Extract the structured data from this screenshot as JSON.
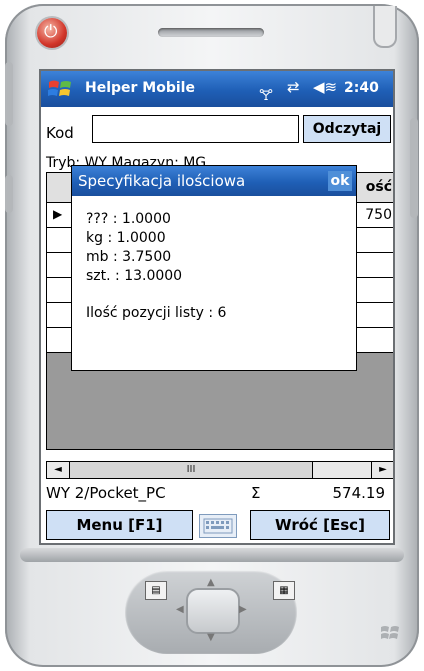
{
  "device": {
    "icons": {
      "power": "power-icon",
      "start": "windows-start-icon",
      "signal": "antenna-icon",
      "sync": "sync-icon",
      "volume": "volume-icon",
      "keyboard": "keyboard-icon"
    }
  },
  "taskbar": {
    "app_title": "Helper Mobile",
    "clock": "2:40"
  },
  "form": {
    "kod_label": "Kod",
    "kod_value": "",
    "read_button": "Odczytaj",
    "mode_text": "Tryb: WY     Magazyn: MG"
  },
  "grid": {
    "header_visible_text": "ość",
    "rows": [
      {
        "selected": true,
        "value_visible": "750"
      },
      {
        "selected": false,
        "value_visible": ""
      },
      {
        "selected": false,
        "value_visible": ""
      },
      {
        "selected": false,
        "value_visible": ""
      },
      {
        "selected": false,
        "value_visible": ""
      },
      {
        "selected": false,
        "value_visible": ""
      }
    ]
  },
  "dialog": {
    "title": "Specyfikacja ilościowa",
    "ok": "ok",
    "lines": [
      "??? : 1.0000",
      "kg : 1.0000",
      "mb : 3.7500",
      "szt. : 13.0000"
    ],
    "count_line": "Ilość pozycji listy : 6"
  },
  "status": {
    "left": "WY 2/Pocket_PC",
    "sigma": "Σ",
    "sum": "574.19"
  },
  "softkeys": {
    "left": "Menu  [F1]",
    "right": "Wróć [Esc]"
  },
  "scroll": {
    "left_arrow": "◄",
    "right_arrow": "►",
    "thumb": "III"
  }
}
